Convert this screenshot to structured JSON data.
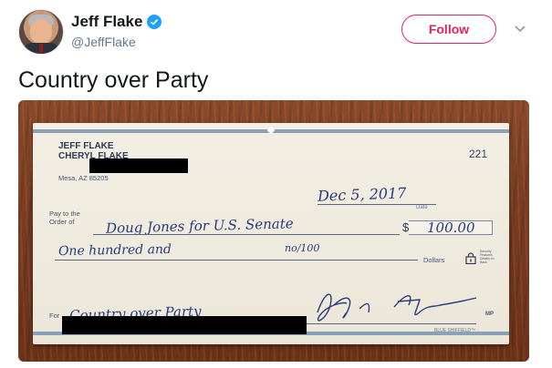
{
  "author": {
    "display_name": "Jeff Flake",
    "handle": "@JeffFlake",
    "verified": true,
    "avatar_icon": "profile-photo"
  },
  "actions": {
    "follow_label": "Follow",
    "menu_icon": "chevron-down-icon"
  },
  "tweet": {
    "text": "Country over Party"
  },
  "check": {
    "owner_line_1": "JEFF FLAKE",
    "owner_line_2": "CHERYL FLAKE",
    "address": "Mesa, AZ 85205",
    "check_number": "221",
    "date": "Dec 5, 2017",
    "date_label": "Date",
    "pay_to_label_1": "Pay to the",
    "pay_to_label_2": "Order of",
    "payee": "Doug Jones for U.S. Senate",
    "amount_numeric": "100.00",
    "amount_words": "One hundred and",
    "amount_fraction": "no/100",
    "dollars_label": "Dollars",
    "memo_label": "For",
    "memo": "Country over Party",
    "mp_mark": "MP",
    "security_note": "Security Features Details on Back",
    "micro_text": "BLUE SHIFFIELD™",
    "colors": {
      "paper": "#efeadd",
      "ink": "#2a3a7a",
      "border_band": "#8aa0b8"
    }
  },
  "theme": {
    "follow_color": "#e0245e",
    "verified_color": "#1da1f2"
  }
}
